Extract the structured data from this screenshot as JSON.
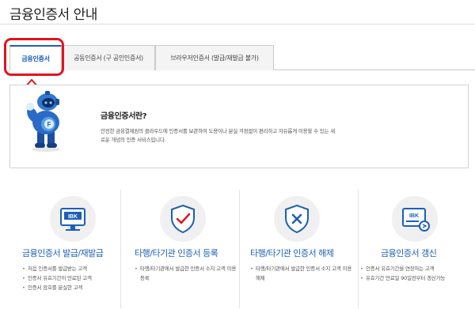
{
  "page": {
    "title": "금융인증서 안내"
  },
  "tabs": [
    {
      "label": "금융인증서",
      "active": true
    },
    {
      "label": "공동인증서 (구 공인인증서)",
      "active": false
    },
    {
      "label": "브라우저인증서 (발급/재발급 불가)",
      "active": false
    }
  ],
  "info": {
    "heading": "금융인증서란?",
    "description": "안전한 금융결제원의 클라우드에 인증서를 보관하여 도용이나 분실 걱정없이 편리하고 자유롭게 이용할 수 있는 새로운 개념의 인증 서비스입니다."
  },
  "cards": [
    {
      "title": "금융인증서 발급/재발급",
      "icon": "monitor-ibk-icon",
      "bullets": [
        "처음 인증서를 발급받는 고객",
        "인증서 유효기간이 만료된 고객",
        "인증서 암호를 분실한 고객"
      ]
    },
    {
      "title": "타행/타기관 인증서 등록",
      "icon": "shield-check-icon",
      "bullets": [
        "타행/타기관에서 발급한 인증서 소지 고객 이용등록"
      ]
    },
    {
      "title": "타행/타기관 인증서 해제",
      "icon": "shield-x-icon",
      "bullets": [
        "타행/타기관에서 발급한 인증서 소지 고객 이용해제"
      ]
    },
    {
      "title": "금융인증서 갱신",
      "icon": "card-renew-icon",
      "bullets": [
        "인증서 유효기간을 연장하는 고객",
        "유효기간 만료일 90일전부터 갱신가능"
      ]
    }
  ],
  "colors": {
    "accent": "#1c5fb8",
    "highlight": "#e0151e",
    "icon_circle": "#f0f0f0"
  },
  "icons": {
    "up_arrow": "up-arrow-icon",
    "mascot": "robot-mascot-icon"
  }
}
